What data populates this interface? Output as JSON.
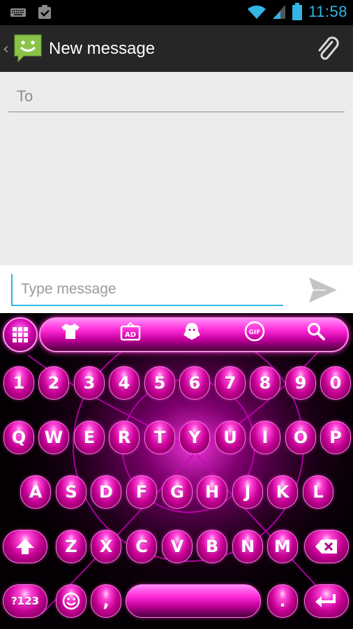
{
  "status_bar": {
    "time": "11:58",
    "icons": [
      "keyboard-icon",
      "clipboard-check-icon",
      "wifi-icon",
      "signal-icon",
      "battery-icon"
    ]
  },
  "action_bar": {
    "title": "New message",
    "logo_icon": "sms-smiley-icon",
    "attach_icon": "paperclip-icon"
  },
  "compose": {
    "to_placeholder": "To",
    "message_placeholder": "Type message",
    "send_icon": "send-icon"
  },
  "keyboard": {
    "toolbar_icons": [
      "grid-menu-icon",
      "tshirt-icon",
      "ad-icon",
      "ghost-icon",
      "gif-icon",
      "search-icon"
    ],
    "gif_label": "GIF",
    "ad_label": "AD",
    "number_row": [
      "1",
      "2",
      "3",
      "4",
      "5",
      "6",
      "7",
      "8",
      "9",
      "0"
    ],
    "row1": [
      "Q",
      "W",
      "E",
      "R",
      "T",
      "Y",
      "U",
      "I",
      "O",
      "P"
    ],
    "row2": [
      "A",
      "S",
      "D",
      "F",
      "G",
      "H",
      "J",
      "K",
      "L"
    ],
    "row3": [
      "Z",
      "X",
      "C",
      "V",
      "B",
      "N",
      "M"
    ],
    "symbols_key": "?123",
    "comma_key": ",",
    "period_key": ".",
    "shift_icon": "shift-arrow-icon",
    "backspace_icon": "backspace-icon",
    "emoji_icon": "smiley-icon",
    "enter_icon": "enter-icon",
    "accent_color": "#ff2ad8",
    "clock_color": "#33b5e5"
  }
}
